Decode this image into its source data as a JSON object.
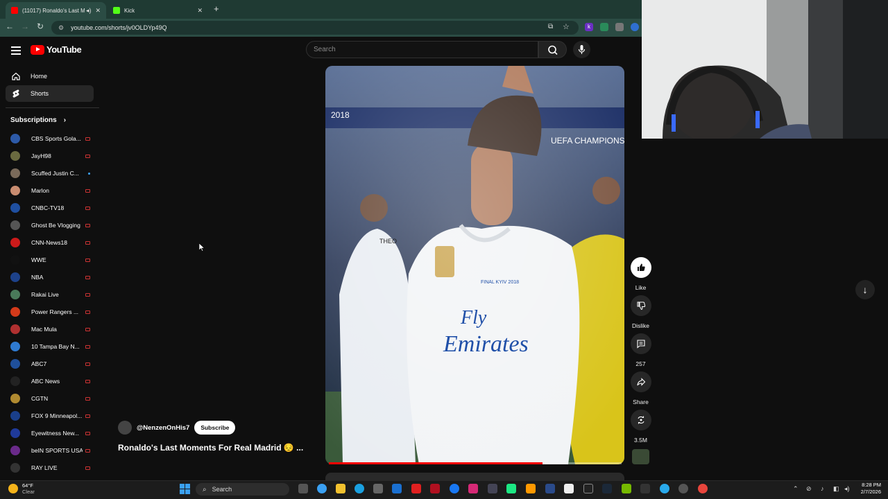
{
  "browser": {
    "tabs": [
      {
        "title": "(11017) Ronaldo's Last Mo",
        "active": true
      },
      {
        "title": "Kick",
        "active": false
      }
    ],
    "url": "youtube.com/shorts/jv0OLDYp49Q"
  },
  "youtube": {
    "logo_text": "YouTube",
    "search_placeholder": "Search",
    "nav": [
      {
        "label": "Home"
      },
      {
        "label": "Shorts"
      }
    ],
    "subscriptions_heading": "Subscriptions",
    "subscriptions": [
      {
        "name": "CBS Sports Gola...",
        "color": "#2d5aa8",
        "status": "live"
      },
      {
        "name": "JayH98",
        "color": "#6a6a40",
        "status": "live"
      },
      {
        "name": "Scuffed Justin C...",
        "color": "#7a6a5a",
        "status": "new"
      },
      {
        "name": "Marlon",
        "color": "#c98c70",
        "status": "live"
      },
      {
        "name": "CNBC-TV18",
        "color": "#1f4fa0",
        "status": "live"
      },
      {
        "name": "Ghost Be Vlogging",
        "color": "#555555",
        "status": "live"
      },
      {
        "name": "CNN-News18",
        "color": "#cc1a1a",
        "status": "live"
      },
      {
        "name": "WWE",
        "color": "#111111",
        "status": "live"
      },
      {
        "name": "NBA",
        "color": "#1d428a",
        "status": "live"
      },
      {
        "name": "Rakai Live",
        "color": "#4a7a5a",
        "status": "live"
      },
      {
        "name": "Power Rangers ...",
        "color": "#d43a1a",
        "status": "live"
      },
      {
        "name": "Mac Mula",
        "color": "#b03030",
        "status": "live"
      },
      {
        "name": "10 Tampa Bay N...",
        "color": "#2f7ad0",
        "status": "live"
      },
      {
        "name": "ABC7",
        "color": "#1f4f9a",
        "status": "live"
      },
      {
        "name": "ABC News",
        "color": "#222222",
        "status": "live"
      },
      {
        "name": "CGTN",
        "color": "#b08a30",
        "status": "live"
      },
      {
        "name": "FOX 9 Minneapol...",
        "color": "#1a3f8a",
        "status": "live"
      },
      {
        "name": "Eyewitness New...",
        "color": "#1f3a9a",
        "status": "live"
      },
      {
        "name": "beIN SPORTS USA",
        "color": "#6a2a8a",
        "status": "live"
      },
      {
        "name": "RAY LIVE",
        "color": "#333333",
        "status": "live"
      }
    ],
    "short": {
      "channel_handle": "@NenzenOnHis7",
      "subscribe_label": "Subscribe",
      "title": "Ronaldo's Last Moments For Real Madrid 😔 ...",
      "progress": 0.73,
      "overlay_texts": [
        "2018",
        "UEFA CHAMPIONS",
        "THEO",
        "Fly",
        "Emirates",
        "FINAL KYIV 2018"
      ]
    },
    "actions": [
      {
        "icon": "like-icon",
        "label": "Like"
      },
      {
        "icon": "dislike-icon",
        "label": "Dislike"
      },
      {
        "icon": "comment-icon",
        "label": "257"
      },
      {
        "icon": "share-icon",
        "label": "Share"
      },
      {
        "icon": "remix-icon",
        "label": "3.5M"
      }
    ]
  },
  "taskbar": {
    "weather_temp": "64°F",
    "weather_desc": "Clear",
    "search_label": "Search",
    "time": "8:28 PM",
    "date": "2/7/2026"
  }
}
